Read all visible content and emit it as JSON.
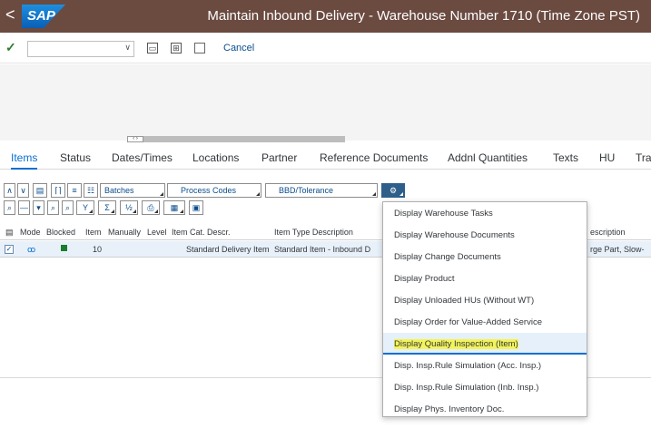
{
  "titlebar": {
    "back": "<",
    "logo": "SAP",
    "title": "Maintain Inbound Delivery - Warehouse Number 1710 (Time Zone PST)"
  },
  "toolbar": {
    "cancel_label": "Cancel",
    "command_value": ""
  },
  "tabs": [
    "Items",
    "Status",
    "Dates/Times",
    "Locations",
    "Partner",
    "Reference Documents",
    "Addnl Quantities",
    "Texts",
    "HU",
    "Tra"
  ],
  "buttons": {
    "batches": "Batches",
    "process_codes": "Process Codes",
    "bbd": "BBD/Tolerance"
  },
  "columns": [
    "Mode",
    "Blocked",
    "Item",
    "Manually",
    "Level",
    "Item Cat. Descr.",
    "Item Type Description",
    "escription"
  ],
  "row": {
    "item": "10",
    "cat_descr": "Standard Delivery Item",
    "type_descr": "Standard Item - Inbound D",
    "descr": "rge Part, Slow-"
  },
  "menu": [
    "Display Warehouse Tasks",
    "Display Warehouse Documents",
    "Display Change Documents",
    "Display Product",
    "Display Unloaded HUs (Without WT)",
    "Display Order for Value-Added Service",
    "Display Quality Inspection (Item)",
    "Disp. Insp.Rule Simulation (Acc. Insp.)",
    "Disp. Insp.Rule Simulation (Inb. Insp.)",
    "Display Phys. Inventory Doc."
  ],
  "menu_selected_index": 6,
  "colors": {
    "titlebar": "#6b4a40",
    "accent": "#0a6ed1",
    "highlight": "#f4f45a"
  }
}
